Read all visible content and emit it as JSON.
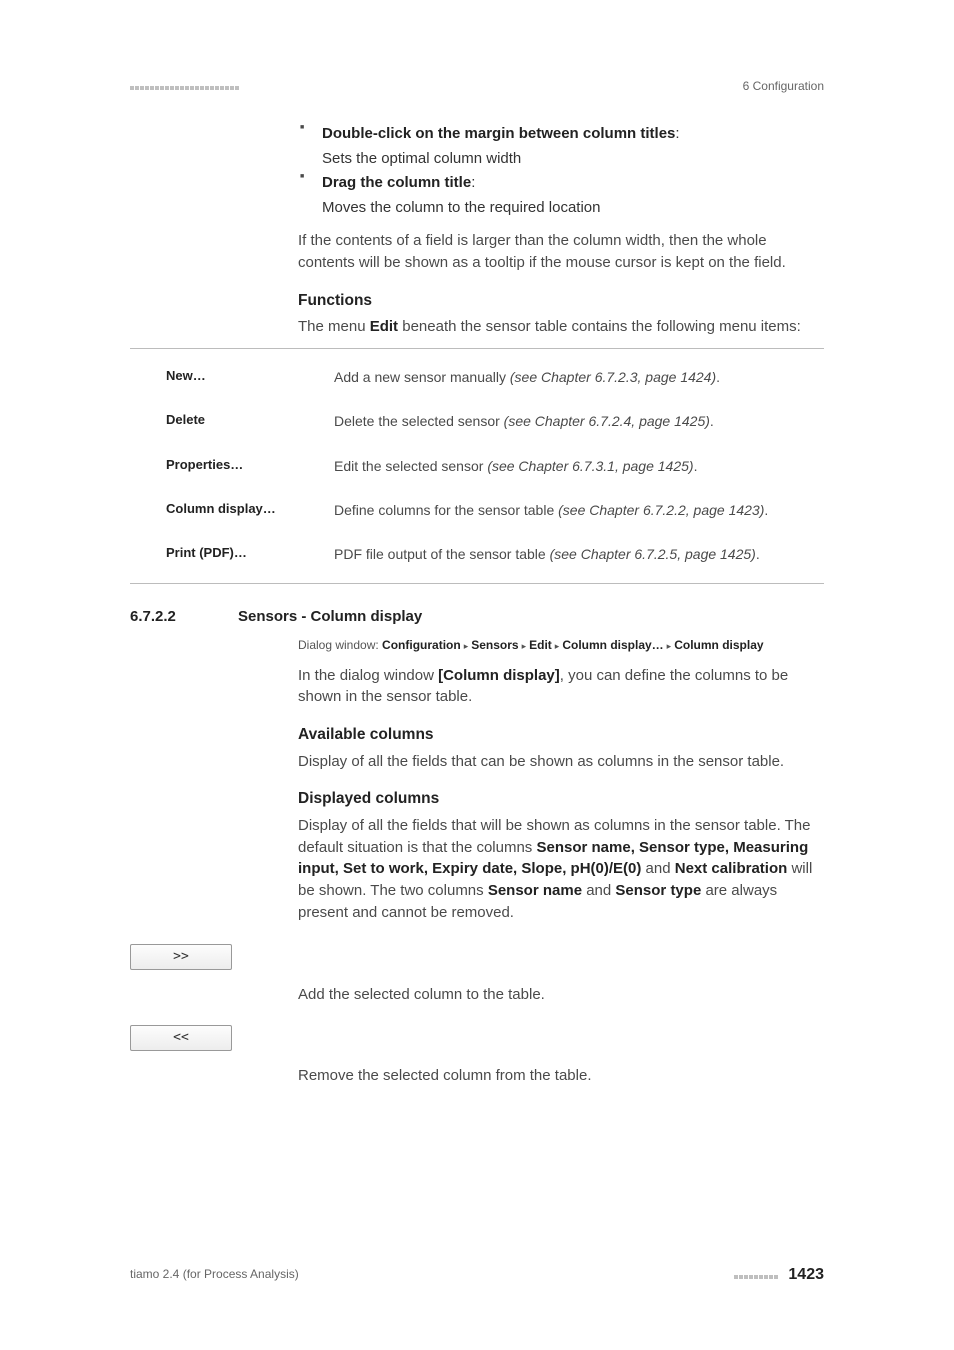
{
  "header": {
    "chapter": "6 Configuration"
  },
  "bullets": {
    "b1_title": "Double-click on the margin between column titles",
    "b1_desc": "Sets the optimal column width",
    "b2_title": "Drag the column title",
    "b2_desc": "Moves the column to the required location"
  },
  "para_tooltip": "If the contents of a field is larger than the column width, then the whole contents will be shown as a tooltip if the mouse cursor is kept on the field.",
  "functions": {
    "heading": "Functions",
    "intro_a": "The menu ",
    "intro_bold": "Edit",
    "intro_b": " beneath the sensor table contains the following menu items:",
    "rows": [
      {
        "term": "New…",
        "desc_a": "Add a new sensor manually ",
        "desc_i": "(see Chapter 6.7.2.3, page 1424)",
        "desc_b": "."
      },
      {
        "term": "Delete",
        "desc_a": "Delete the selected sensor ",
        "desc_i": "(see Chapter 6.7.2.4, page 1425)",
        "desc_b": "."
      },
      {
        "term": "Properties…",
        "desc_a": "Edit the selected sensor ",
        "desc_i": "(see Chapter 6.7.3.1, page 1425)",
        "desc_b": "."
      },
      {
        "term": "Column display…",
        "desc_a": "Define columns for the sensor table ",
        "desc_i": "(see Chapter 6.7.2.2, page 1423)",
        "desc_b": "."
      },
      {
        "term": "Print (PDF)…",
        "desc_a": "PDF file output of the sensor table ",
        "desc_i": "(see Chapter 6.7.2.5, page 1425)",
        "desc_b": "."
      }
    ]
  },
  "section": {
    "num": "6.7.2.2",
    "title": "Sensors - Column display",
    "dialog_prefix": "Dialog window: ",
    "dialog_parts": [
      "Configuration",
      "Sensors",
      "Edit",
      "Column display…",
      "Column display"
    ],
    "intro_a": "In the dialog window ",
    "intro_bold": "[Column display]",
    "intro_b": ", you can define the columns to be shown in the sensor table.",
    "avail_heading": "Available columns",
    "avail_desc": "Display of all the fields that can be shown as columns in the sensor table.",
    "disp_heading": "Displayed columns",
    "disp_a": "Display of all the fields that will be shown as columns in the sensor table. The default situation is that the columns ",
    "disp_bold1": "Sensor name, Sensor type, Measuring input, Set to work, Expiry date, Slope, pH(0)/E(0)",
    "disp_b": " and ",
    "disp_bold2": "Next calibration",
    "disp_c": " will be shown. The two columns ",
    "disp_bold3": "Sensor name",
    "disp_d": " and ",
    "disp_bold4": "Sensor type",
    "disp_e": " are always present and cannot be removed.",
    "btn_add": ">>",
    "btn_add_desc": "Add the selected column to the table.",
    "btn_rem": "<<",
    "btn_rem_desc": "Remove the selected column from the table."
  },
  "footer": {
    "product": "tiamo 2.4 (for Process Analysis)",
    "page": "1423"
  }
}
